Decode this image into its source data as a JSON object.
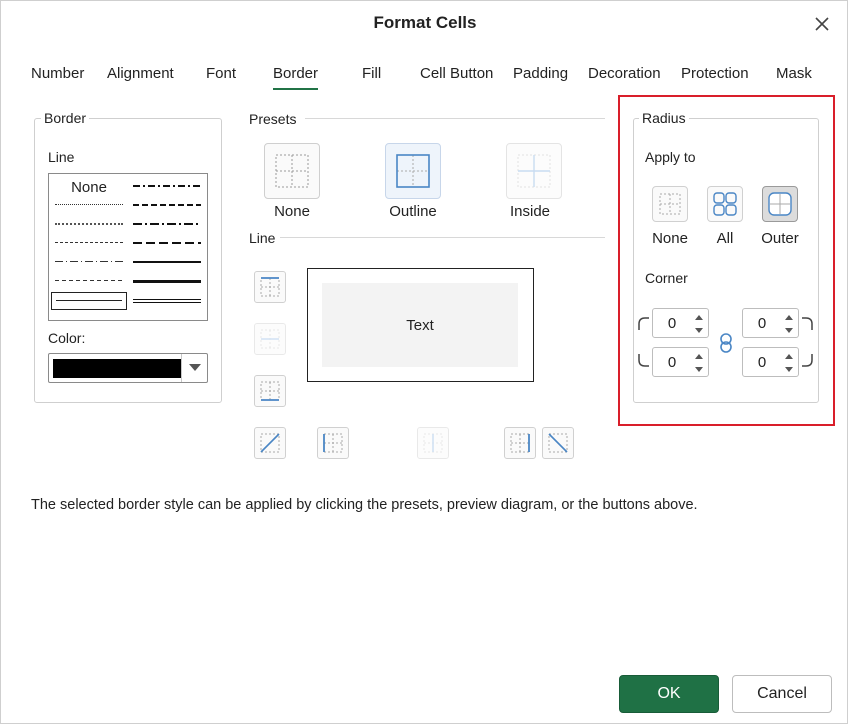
{
  "dialog": {
    "title": "Format Cells"
  },
  "tabs": [
    {
      "label": "Number"
    },
    {
      "label": "Alignment"
    },
    {
      "label": "Font"
    },
    {
      "label": "Border",
      "active": true
    },
    {
      "label": "Fill"
    },
    {
      "label": "Cell Button"
    },
    {
      "label": "Padding"
    },
    {
      "label": "Decoration"
    },
    {
      "label": "Protection"
    },
    {
      "label": "Mask"
    }
  ],
  "border_group": {
    "legend": "Border",
    "line_label": "Line",
    "line_none": "None",
    "color_label": "Color:",
    "color_value": "#000000"
  },
  "presets": {
    "legend": "Presets",
    "items": [
      {
        "label": "None"
      },
      {
        "label": "Outline",
        "selected": true
      },
      {
        "label": "Inside",
        "disabled": true
      }
    ]
  },
  "line_section": {
    "legend": "Line"
  },
  "preview": {
    "text": "Text"
  },
  "hint": "The selected border style can be applied by clicking the presets, preview diagram, or the buttons above.",
  "radius": {
    "legend": "Radius",
    "apply_to_label": "Apply to",
    "apply_options": [
      {
        "label": "None"
      },
      {
        "label": "All"
      },
      {
        "label": "Outer",
        "selected": true
      }
    ],
    "corner_label": "Corner",
    "corners": {
      "top_left": "0",
      "top_right": "0",
      "bottom_left": "0",
      "bottom_right": "0"
    }
  },
  "buttons": {
    "ok": "OK",
    "cancel": "Cancel"
  },
  "colors": {
    "accent": "#1f7145",
    "highlight": "#d91e2a",
    "icon_blue": "#4a86c5"
  }
}
